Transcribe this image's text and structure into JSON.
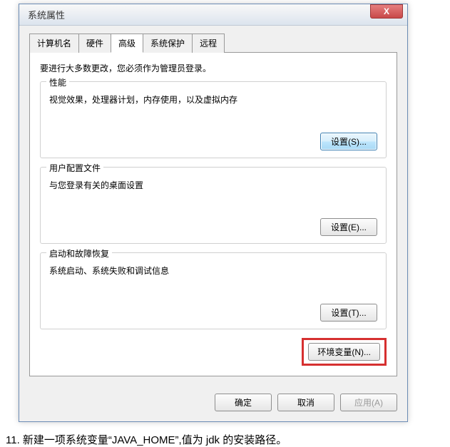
{
  "window": {
    "title": "系统属性",
    "close_label": "X"
  },
  "tabs": {
    "t0": "计算机名",
    "t1": "硬件",
    "t2": "高级",
    "t3": "系统保护",
    "t4": "远程"
  },
  "panel": {
    "intro": "要进行大多数更改，您必须作为管理员登录。",
    "perf": {
      "title": "性能",
      "desc": "视觉效果，处理器计划，内存使用，以及虚拟内存",
      "btn": "设置(S)..."
    },
    "profile": {
      "title": "用户配置文件",
      "desc": "与您登录有关的桌面设置",
      "btn": "设置(E)..."
    },
    "startup": {
      "title": "启动和故障恢复",
      "desc": "系统启动、系统失败和调试信息",
      "btn": "设置(T)..."
    },
    "env_btn": "环境变量(N)..."
  },
  "buttons": {
    "ok": "确定",
    "cancel": "取消",
    "apply": "应用(A)"
  },
  "caption": "11.  新建一项系统变量“JAVA_HOME”,值为 jdk 的安装路径。"
}
